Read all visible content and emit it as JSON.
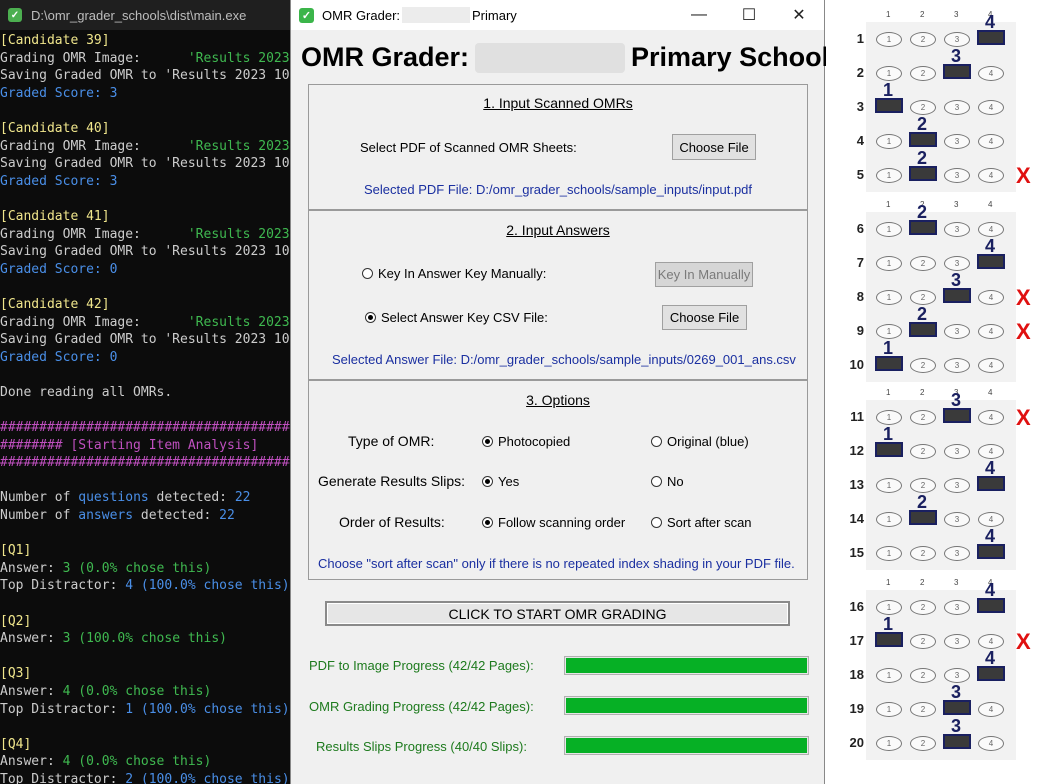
{
  "terminal": {
    "title": "D:\\omr_grader_schools\\dist\\main.exe",
    "lines": [
      {
        "segs": [
          {
            "t": "[Candidate 39]",
            "c": "c-y"
          }
        ]
      },
      {
        "segs": [
          {
            "t": "Grading OMR Image:      ",
            "c": "c-w"
          },
          {
            "t": "'Results 2023",
            "c": "c-g"
          }
        ]
      },
      {
        "segs": [
          {
            "t": "Saving Graded OMR to 'Results 2023 10",
            "c": "c-w"
          }
        ]
      },
      {
        "segs": [
          {
            "t": "Graded Score: 3",
            "c": "c-b"
          }
        ]
      },
      {
        "segs": [
          {
            "t": "",
            "c": "c-w"
          }
        ]
      },
      {
        "segs": [
          {
            "t": "[Candidate 40]",
            "c": "c-y"
          }
        ]
      },
      {
        "segs": [
          {
            "t": "Grading OMR Image:      ",
            "c": "c-w"
          },
          {
            "t": "'Results 2023",
            "c": "c-g"
          }
        ]
      },
      {
        "segs": [
          {
            "t": "Saving Graded OMR to 'Results 2023 10",
            "c": "c-w"
          }
        ]
      },
      {
        "segs": [
          {
            "t": "Graded Score: 3",
            "c": "c-b"
          }
        ]
      },
      {
        "segs": [
          {
            "t": "",
            "c": "c-w"
          }
        ]
      },
      {
        "segs": [
          {
            "t": "[Candidate 41]",
            "c": "c-y"
          }
        ]
      },
      {
        "segs": [
          {
            "t": "Grading OMR Image:      ",
            "c": "c-w"
          },
          {
            "t": "'Results 2023",
            "c": "c-g"
          }
        ]
      },
      {
        "segs": [
          {
            "t": "Saving Graded OMR to 'Results 2023 10",
            "c": "c-w"
          }
        ]
      },
      {
        "segs": [
          {
            "t": "Graded Score: 0",
            "c": "c-b"
          }
        ]
      },
      {
        "segs": [
          {
            "t": "",
            "c": "c-w"
          }
        ]
      },
      {
        "segs": [
          {
            "t": "[Candidate 42]",
            "c": "c-y"
          }
        ]
      },
      {
        "segs": [
          {
            "t": "Grading OMR Image:      ",
            "c": "c-w"
          },
          {
            "t": "'Results 2023",
            "c": "c-g"
          }
        ]
      },
      {
        "segs": [
          {
            "t": "Saving Graded OMR to 'Results 2023 10",
            "c": "c-w"
          }
        ]
      },
      {
        "segs": [
          {
            "t": "Graded Score: 0",
            "c": "c-b"
          }
        ]
      },
      {
        "segs": [
          {
            "t": "",
            "c": "c-w"
          }
        ]
      },
      {
        "segs": [
          {
            "t": "Done reading all OMRs.",
            "c": "c-w"
          }
        ]
      },
      {
        "segs": [
          {
            "t": "",
            "c": "c-w"
          }
        ]
      },
      {
        "segs": [
          {
            "t": "########################################",
            "c": "c-m"
          }
        ]
      },
      {
        "segs": [
          {
            "t": "######## [Starting Item Analysis]",
            "c": "c-m"
          }
        ]
      },
      {
        "segs": [
          {
            "t": "########################################",
            "c": "c-m"
          }
        ]
      },
      {
        "segs": [
          {
            "t": "",
            "c": "c-w"
          }
        ]
      },
      {
        "segs": [
          {
            "t": "Number of ",
            "c": "c-w"
          },
          {
            "t": "questions",
            "c": "c-b"
          },
          {
            "t": " detected: ",
            "c": "c-w"
          },
          {
            "t": "22",
            "c": "c-b"
          }
        ]
      },
      {
        "segs": [
          {
            "t": "Number of ",
            "c": "c-w"
          },
          {
            "t": "answers",
            "c": "c-b"
          },
          {
            "t": " detected: ",
            "c": "c-w"
          },
          {
            "t": "22",
            "c": "c-b"
          }
        ]
      },
      {
        "segs": [
          {
            "t": "",
            "c": "c-w"
          }
        ]
      },
      {
        "segs": [
          {
            "t": "[Q1]",
            "c": "c-y"
          }
        ]
      },
      {
        "segs": [
          {
            "t": "Answer: ",
            "c": "c-w"
          },
          {
            "t": "3 (0.0% chose this)",
            "c": "c-g"
          }
        ]
      },
      {
        "segs": [
          {
            "t": "Top Distractor: ",
            "c": "c-w"
          },
          {
            "t": "4 (100.0% chose this)",
            "c": "c-b"
          }
        ]
      },
      {
        "segs": [
          {
            "t": "",
            "c": "c-w"
          }
        ]
      },
      {
        "segs": [
          {
            "t": "[Q2]",
            "c": "c-y"
          }
        ]
      },
      {
        "segs": [
          {
            "t": "Answer: ",
            "c": "c-w"
          },
          {
            "t": "3 (100.0% chose this)",
            "c": "c-g"
          }
        ]
      },
      {
        "segs": [
          {
            "t": "",
            "c": "c-w"
          }
        ]
      },
      {
        "segs": [
          {
            "t": "[Q3]",
            "c": "c-y"
          }
        ]
      },
      {
        "segs": [
          {
            "t": "Answer: ",
            "c": "c-w"
          },
          {
            "t": "4 (0.0% chose this)",
            "c": "c-g"
          }
        ]
      },
      {
        "segs": [
          {
            "t": "Top Distractor: ",
            "c": "c-w"
          },
          {
            "t": "1 (100.0% chose this)",
            "c": "c-b"
          }
        ]
      },
      {
        "segs": [
          {
            "t": "",
            "c": "c-w"
          }
        ]
      },
      {
        "segs": [
          {
            "t": "[Q4]",
            "c": "c-y"
          }
        ]
      },
      {
        "segs": [
          {
            "t": "Answer: ",
            "c": "c-w"
          },
          {
            "t": "4 (0.0% chose this)",
            "c": "c-g"
          }
        ]
      },
      {
        "segs": [
          {
            "t": "Top Distractor: ",
            "c": "c-w"
          },
          {
            "t": "2 (100.0% chose this)",
            "c": "c-b"
          }
        ]
      }
    ]
  },
  "window": {
    "title_prefix": "OMR Grader:",
    "title_suffix": "Primary",
    "controls": {
      "minimize": "—",
      "maximize": "☐",
      "close": "✕"
    }
  },
  "main_title": {
    "prefix": "OMR Grader:",
    "suffix": "Primary School"
  },
  "section1": {
    "heading": "1. Input Scanned OMRs",
    "select_label": "Select PDF of Scanned OMR Sheets:",
    "choose_button": "Choose File",
    "selected_text": "Selected PDF File: D:/omr_grader_schools/sample_inputs/input.pdf"
  },
  "section2": {
    "heading": "2. Input Answers",
    "manual_label": "Key In Answer Key Manually:",
    "manual_button": "Key In Manually",
    "csv_label": "Select Answer Key CSV File:",
    "csv_button": "Choose File",
    "selected_text": "Selected Answer File: D:/omr_grader_schools/sample_inputs/0269_001_ans.csv"
  },
  "section3": {
    "heading": "3. Options",
    "type_label": "Type of OMR:",
    "type_opt1": "Photocopied",
    "type_opt2": "Original (blue)",
    "slips_label": "Generate Results Slips:",
    "slips_opt1": "Yes",
    "slips_opt2": "No",
    "order_label": "Order of Results:",
    "order_opt1": "Follow scanning order",
    "order_opt2": "Sort after scan",
    "note": "Choose \"sort after scan\" only if there is no repeated index shading in your PDF file."
  },
  "start_button": "CLICK TO START OMR GRADING",
  "progress": [
    {
      "label": "PDF to Image Progress (42/42 Pages):",
      "value": 1.0
    },
    {
      "label": "OMR Grading Progress (42/42 Pages):",
      "value": 1.0
    },
    {
      "label": "Results Slips Progress (40/40 Slips):",
      "value": 1.0
    }
  ],
  "sheet": {
    "header_nums": [
      "1",
      "2",
      "3",
      "4"
    ],
    "x_symbol": "X",
    "blocks": [
      {
        "rows": [
          {
            "q": "1",
            "mark": 4,
            "hw": "4",
            "wrong": false
          },
          {
            "q": "2",
            "mark": 3,
            "hw": "3",
            "wrong": false
          },
          {
            "q": "3",
            "mark": 1,
            "hw": "1",
            "wrong": false
          },
          {
            "q": "4",
            "mark": 2,
            "hw": "2",
            "wrong": false
          },
          {
            "q": "5",
            "mark": 2,
            "hw": "2",
            "wrong": true
          }
        ]
      },
      {
        "rows": [
          {
            "q": "6",
            "mark": 2,
            "hw": "2",
            "wrong": false
          },
          {
            "q": "7",
            "mark": 4,
            "hw": "4",
            "wrong": false
          },
          {
            "q": "8",
            "mark": 3,
            "hw": "3",
            "wrong": true
          },
          {
            "q": "9",
            "mark": 2,
            "hw": "2",
            "wrong": true
          },
          {
            "q": "10",
            "mark": 1,
            "hw": "1",
            "wrong": false
          }
        ]
      },
      {
        "rows": [
          {
            "q": "11",
            "mark": 3,
            "hw": "3",
            "wrong": true
          },
          {
            "q": "12",
            "mark": 1,
            "hw": "1",
            "wrong": false
          },
          {
            "q": "13",
            "mark": 4,
            "hw": "4",
            "wrong": false
          },
          {
            "q": "14",
            "mark": 2,
            "hw": "2",
            "wrong": false
          },
          {
            "q": "15",
            "mark": 4,
            "hw": "4",
            "wrong": false
          }
        ]
      },
      {
        "rows": [
          {
            "q": "16",
            "mark": 4,
            "hw": "4",
            "wrong": false
          },
          {
            "q": "17",
            "mark": 1,
            "hw": "1",
            "wrong": true
          },
          {
            "q": "18",
            "mark": 4,
            "hw": "4",
            "wrong": false
          },
          {
            "q": "19",
            "mark": 3,
            "hw": "3",
            "wrong": false
          },
          {
            "q": "20",
            "mark": 3,
            "hw": "3",
            "wrong": false
          }
        ]
      }
    ]
  }
}
